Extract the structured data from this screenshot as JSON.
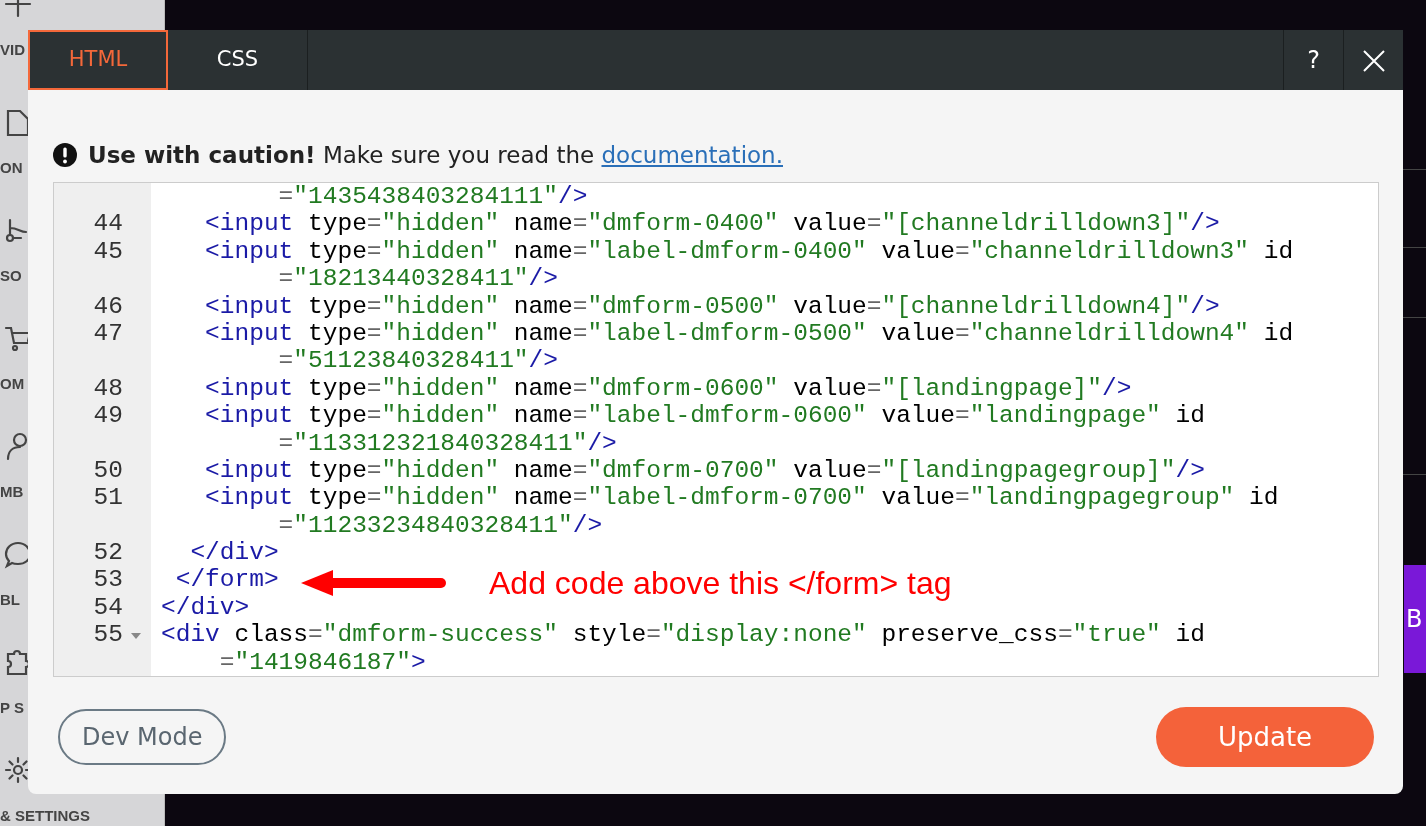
{
  "sidebar": {
    "items": [
      {
        "kind": "plus"
      },
      {
        "kind": "video",
        "label": "VID"
      },
      {
        "kind": "document",
        "label": "ON"
      },
      {
        "kind": "nodes",
        "label": "SO"
      },
      {
        "kind": "cart",
        "label": "OM"
      },
      {
        "kind": "person",
        "label": "MB"
      },
      {
        "kind": "chat",
        "label": "BL"
      },
      {
        "kind": "puzzle",
        "label": "P S"
      },
      {
        "kind": "gear",
        "label": "& SETTINGS"
      }
    ]
  },
  "background_button": {
    "label": "B"
  },
  "dialog": {
    "tabs": [
      {
        "label": "HTML",
        "selected": true
      },
      {
        "label": "CSS",
        "selected": false
      }
    ],
    "help_button": "?",
    "warning": {
      "bold": "Use with caution!",
      "text": "Make sure you read the",
      "link": "documentation."
    },
    "code_lines": [
      {
        "tokens": [
          {
            "kind": "punct",
            "text": "        ="
          },
          {
            "kind": "string",
            "text": "\"1435438403284111\""
          },
          {
            "kind": "tag",
            "text": "/>"
          }
        ]
      },
      {
        "number": "44",
        "tokens": [
          {
            "kind": "tag",
            "text": "   <input"
          },
          {
            "kind": "attr",
            "text": " type"
          },
          {
            "kind": "punct",
            "text": "="
          },
          {
            "kind": "string",
            "text": "\"hidden\""
          },
          {
            "kind": "attr",
            "text": " name"
          },
          {
            "kind": "punct",
            "text": "="
          },
          {
            "kind": "string",
            "text": "\"dmform-0400\""
          },
          {
            "kind": "attr",
            "text": " value"
          },
          {
            "kind": "punct",
            "text": "="
          },
          {
            "kind": "string",
            "text": "\"[channeldrilldown3]\""
          },
          {
            "kind": "tag",
            "text": "/>"
          }
        ]
      },
      {
        "number": "45",
        "tokens": [
          {
            "kind": "tag",
            "text": "   <input"
          },
          {
            "kind": "attr",
            "text": " type"
          },
          {
            "kind": "punct",
            "text": "="
          },
          {
            "kind": "string",
            "text": "\"hidden\""
          },
          {
            "kind": "attr",
            "text": " name"
          },
          {
            "kind": "punct",
            "text": "="
          },
          {
            "kind": "string",
            "text": "\"label-dmform-0400\""
          },
          {
            "kind": "attr",
            "text": " value"
          },
          {
            "kind": "punct",
            "text": "="
          },
          {
            "kind": "string",
            "text": "\"channeldrilldown3\""
          },
          {
            "kind": "attr",
            "text": " id"
          }
        ]
      },
      {
        "tokens": [
          {
            "kind": "punct",
            "text": "        ="
          },
          {
            "kind": "string",
            "text": "\"18213440328411\""
          },
          {
            "kind": "tag",
            "text": "/>"
          }
        ]
      },
      {
        "number": "46",
        "tokens": [
          {
            "kind": "tag",
            "text": "   <input"
          },
          {
            "kind": "attr",
            "text": " type"
          },
          {
            "kind": "punct",
            "text": "="
          },
          {
            "kind": "string",
            "text": "\"hidden\""
          },
          {
            "kind": "attr",
            "text": " name"
          },
          {
            "kind": "punct",
            "text": "="
          },
          {
            "kind": "string",
            "text": "\"dmform-0500\""
          },
          {
            "kind": "attr",
            "text": " value"
          },
          {
            "kind": "punct",
            "text": "="
          },
          {
            "kind": "string",
            "text": "\"[channeldrilldown4]\""
          },
          {
            "kind": "tag",
            "text": "/>"
          }
        ]
      },
      {
        "number": "47",
        "tokens": [
          {
            "kind": "tag",
            "text": "   <input"
          },
          {
            "kind": "attr",
            "text": " type"
          },
          {
            "kind": "punct",
            "text": "="
          },
          {
            "kind": "string",
            "text": "\"hidden\""
          },
          {
            "kind": "attr",
            "text": " name"
          },
          {
            "kind": "punct",
            "text": "="
          },
          {
            "kind": "string",
            "text": "\"label-dmform-0500\""
          },
          {
            "kind": "attr",
            "text": " value"
          },
          {
            "kind": "punct",
            "text": "="
          },
          {
            "kind": "string",
            "text": "\"channeldrilldown4\""
          },
          {
            "kind": "attr",
            "text": " id"
          }
        ]
      },
      {
        "tokens": [
          {
            "kind": "punct",
            "text": "        ="
          },
          {
            "kind": "string",
            "text": "\"51123840328411\""
          },
          {
            "kind": "tag",
            "text": "/>"
          }
        ]
      },
      {
        "number": "48",
        "tokens": [
          {
            "kind": "tag",
            "text": "   <input"
          },
          {
            "kind": "attr",
            "text": " type"
          },
          {
            "kind": "punct",
            "text": "="
          },
          {
            "kind": "string",
            "text": "\"hidden\""
          },
          {
            "kind": "attr",
            "text": " name"
          },
          {
            "kind": "punct",
            "text": "="
          },
          {
            "kind": "string",
            "text": "\"dmform-0600\""
          },
          {
            "kind": "attr",
            "text": " value"
          },
          {
            "kind": "punct",
            "text": "="
          },
          {
            "kind": "string",
            "text": "\"[landingpage]\""
          },
          {
            "kind": "tag",
            "text": "/>"
          }
        ]
      },
      {
        "number": "49",
        "tokens": [
          {
            "kind": "tag",
            "text": "   <input"
          },
          {
            "kind": "attr",
            "text": " type"
          },
          {
            "kind": "punct",
            "text": "="
          },
          {
            "kind": "string",
            "text": "\"hidden\""
          },
          {
            "kind": "attr",
            "text": " name"
          },
          {
            "kind": "punct",
            "text": "="
          },
          {
            "kind": "string",
            "text": "\"label-dmform-0600\""
          },
          {
            "kind": "attr",
            "text": " value"
          },
          {
            "kind": "punct",
            "text": "="
          },
          {
            "kind": "string",
            "text": "\"landingpage\""
          },
          {
            "kind": "attr",
            "text": " id"
          }
        ]
      },
      {
        "tokens": [
          {
            "kind": "punct",
            "text": "        ="
          },
          {
            "kind": "string",
            "text": "\"113312321840328411\""
          },
          {
            "kind": "tag",
            "text": "/>"
          }
        ]
      },
      {
        "number": "50",
        "tokens": [
          {
            "kind": "tag",
            "text": "   <input"
          },
          {
            "kind": "attr",
            "text": " type"
          },
          {
            "kind": "punct",
            "text": "="
          },
          {
            "kind": "string",
            "text": "\"hidden\""
          },
          {
            "kind": "attr",
            "text": " name"
          },
          {
            "kind": "punct",
            "text": "="
          },
          {
            "kind": "string",
            "text": "\"dmform-0700\""
          },
          {
            "kind": "attr",
            "text": " value"
          },
          {
            "kind": "punct",
            "text": "="
          },
          {
            "kind": "string",
            "text": "\"[landingpagegroup]\""
          },
          {
            "kind": "tag",
            "text": "/>"
          }
        ]
      },
      {
        "number": "51",
        "tokens": [
          {
            "kind": "tag",
            "text": "   <input"
          },
          {
            "kind": "attr",
            "text": " type"
          },
          {
            "kind": "punct",
            "text": "="
          },
          {
            "kind": "string",
            "text": "\"hidden\""
          },
          {
            "kind": "attr",
            "text": " name"
          },
          {
            "kind": "punct",
            "text": "="
          },
          {
            "kind": "string",
            "text": "\"label-dmform-0700\""
          },
          {
            "kind": "attr",
            "text": " value"
          },
          {
            "kind": "punct",
            "text": "="
          },
          {
            "kind": "string",
            "text": "\"landingpagegroup\""
          },
          {
            "kind": "attr",
            "text": " id"
          }
        ]
      },
      {
        "tokens": [
          {
            "kind": "punct",
            "text": "        ="
          },
          {
            "kind": "string",
            "text": "\"11233234840328411\""
          },
          {
            "kind": "tag",
            "text": "/>"
          }
        ]
      },
      {
        "number": "52",
        "tokens": [
          {
            "kind": "tag",
            "text": "  </div>"
          }
        ]
      },
      {
        "number": "53",
        "tokens": [
          {
            "kind": "tag",
            "text": " </form>"
          }
        ]
      },
      {
        "number": "54",
        "tokens": [
          {
            "kind": "tag",
            "text": "</div>"
          }
        ]
      },
      {
        "number": "55",
        "foldable": true,
        "tokens": [
          {
            "kind": "tag",
            "text": "<div"
          },
          {
            "kind": "attr",
            "text": " class"
          },
          {
            "kind": "punct",
            "text": "="
          },
          {
            "kind": "string",
            "text": "\"dmform-success\""
          },
          {
            "kind": "attr",
            "text": " style"
          },
          {
            "kind": "punct",
            "text": "="
          },
          {
            "kind": "string",
            "text": "\"display:none\""
          },
          {
            "kind": "attr",
            "text": " preserve_css"
          },
          {
            "kind": "punct",
            "text": "="
          },
          {
            "kind": "string",
            "text": "\"true\""
          },
          {
            "kind": "attr",
            "text": " id"
          }
        ]
      },
      {
        "tokens": [
          {
            "kind": "punct",
            "text": "    ="
          },
          {
            "kind": "string",
            "text": "\"1419846187\""
          },
          {
            "kind": "tag",
            "text": ">"
          }
        ]
      }
    ],
    "annotation": {
      "text": "Add code above this </form> tag"
    },
    "dev_mode_button": "Dev Mode",
    "update_button": "Update"
  }
}
